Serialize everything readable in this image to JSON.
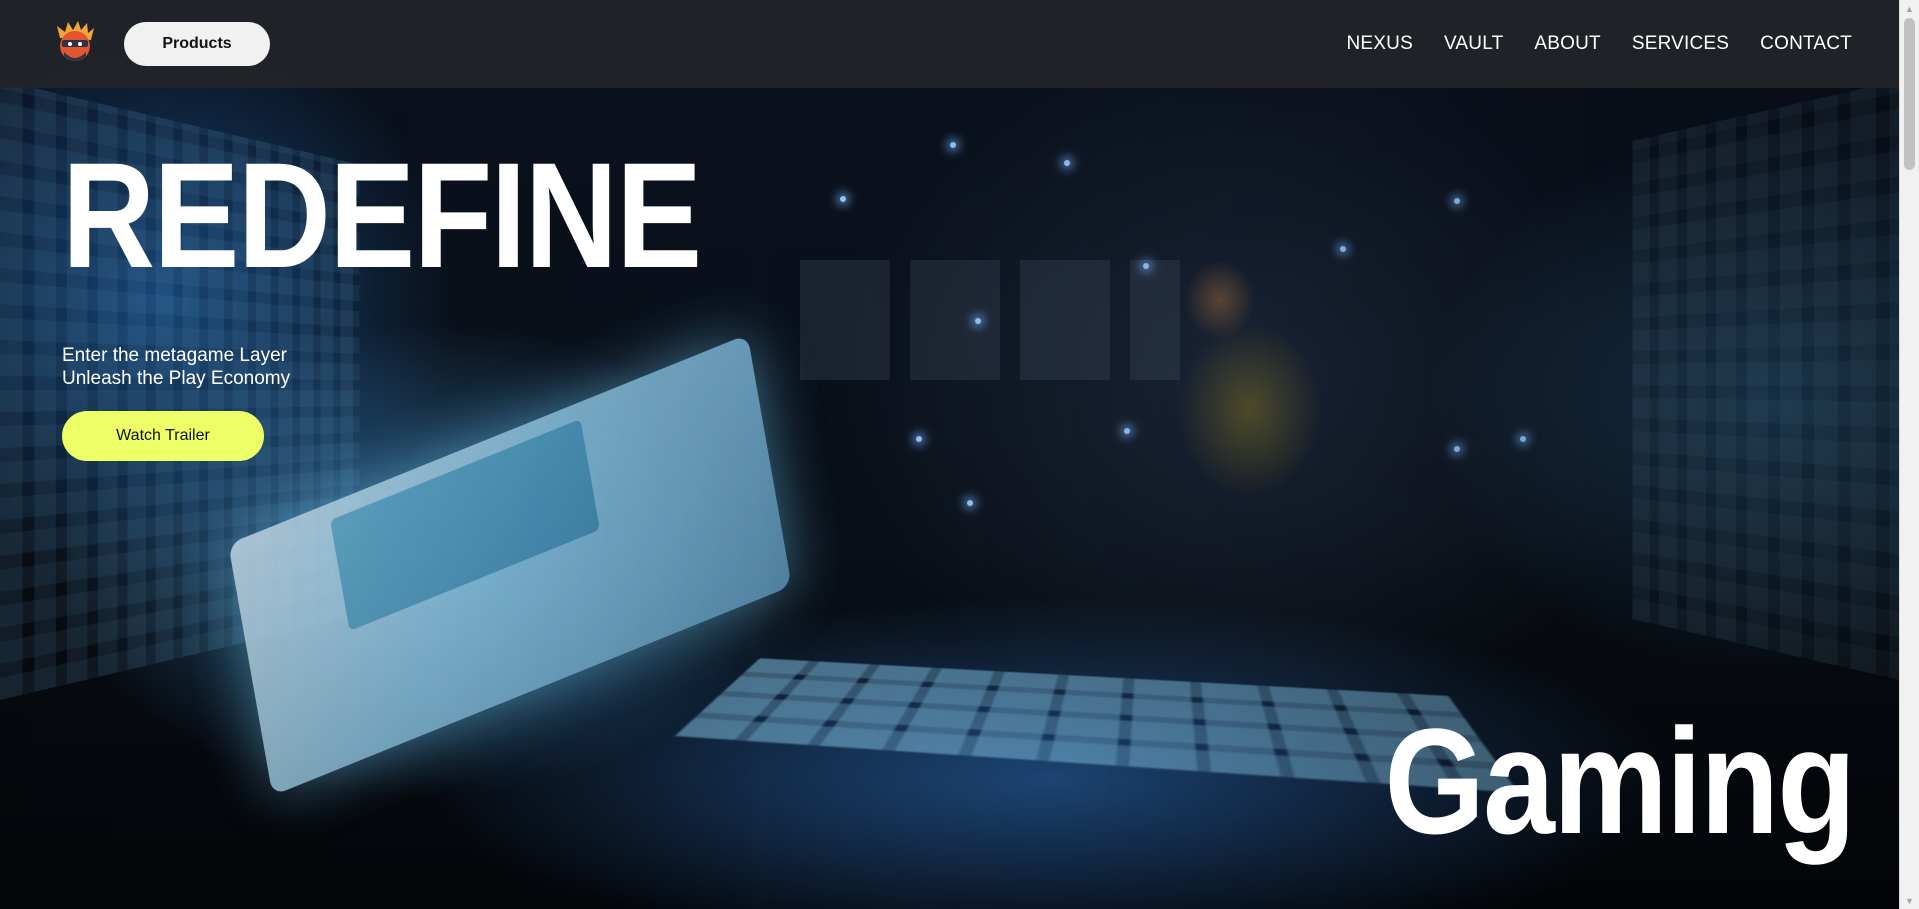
{
  "brand": {
    "logo_icon": "ninja-avatar-logo-icon"
  },
  "header": {
    "products_label": "Products",
    "nav": [
      {
        "label": "NEXUS"
      },
      {
        "label": "VAULT"
      },
      {
        "label": "ABOUT"
      },
      {
        "label": "SERVICES"
      },
      {
        "label": "CONTACT"
      }
    ]
  },
  "hero": {
    "title": "REDEFINE",
    "tagline_line1": "Enter the metagame Layer",
    "tagline_line2": "Unleash the Play Economy",
    "cta_label": "Watch Trailer",
    "corner_word": "Gaming"
  },
  "colors": {
    "accent": "#edff66",
    "header_bg": "#222428",
    "text": "#ffffff"
  }
}
